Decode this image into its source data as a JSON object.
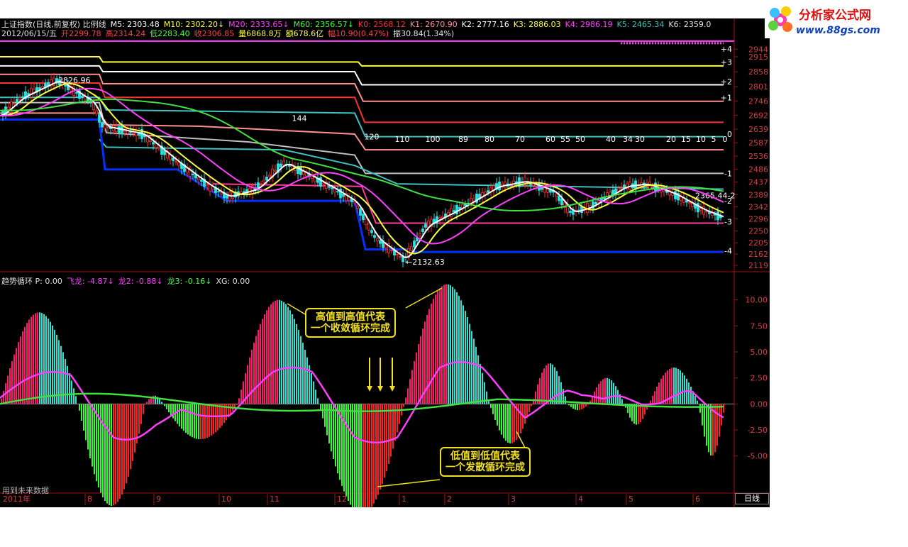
{
  "header": {
    "line1": [
      {
        "text": "上证指数(日线,前复权) 比例线",
        "color": "#e0e0e0"
      },
      {
        "text": "M5: 2303.48",
        "color": "#ffffff"
      },
      {
        "text": "M10: 2302.20↓",
        "color": "#ffff40"
      },
      {
        "text": "M20: 2333.65↓",
        "color": "#ff40ff"
      },
      {
        "text": "M60: 2356.57↓",
        "color": "#40ff40"
      },
      {
        "text": "K0: 2568.12",
        "color": "#ff3030"
      },
      {
        "text": "K1: 2670.90",
        "color": "#ff9090"
      },
      {
        "text": "K2: 2777.16",
        "color": "#ffffff"
      },
      {
        "text": "K3: 2886.03",
        "color": "#ffff40"
      },
      {
        "text": "K4: 2986.19",
        "color": "#ff40ff"
      },
      {
        "text": "K5: 2465.34",
        "color": "#40c0c0"
      },
      {
        "text": "K6: 2359.0",
        "color": "#e0e0e0"
      }
    ],
    "line2": [
      {
        "text": "2012/06/15/五",
        "color": "#e0e0e0"
      },
      {
        "text": "开2299.78",
        "color": "#ff4040"
      },
      {
        "text": "高2314.24",
        "color": "#ff4040"
      },
      {
        "text": "低2283.40",
        "color": "#40ff40"
      },
      {
        "text": "收2306.85",
        "color": "#ff4040"
      },
      {
        "text": "量6868.8万",
        "color": "#ffff40"
      },
      {
        "text": "额678.6亿",
        "color": "#ffff40"
      },
      {
        "text": "幅10.90(0.47%)",
        "color": "#ff4040"
      },
      {
        "text": "振30.84(1.34%)",
        "color": "#e0e0e0"
      }
    ]
  },
  "watermark": {
    "title": "分析家公式网",
    "url": "www.88gs.com"
  },
  "indicator_header": [
    {
      "text": "趋势循环  P: 0.00",
      "color": "#e0e0e0"
    },
    {
      "text": "飞龙: -4.87↓",
      "color": "#ff40ff"
    },
    {
      "text": "龙2: -0.88↓",
      "color": "#ff40ff"
    },
    {
      "text": "龙3: -0.16↓",
      "color": "#40ff40"
    },
    {
      "text": "XG: 0.00",
      "color": "#e0e0e0"
    }
  ],
  "notes": {
    "high": {
      "line1": "高值到高值代表",
      "line2": "一个收敛循环完成"
    },
    "low": {
      "line1": "低值到低值代表",
      "line2": "一个发散循环完成"
    }
  },
  "footer_text": "用到未来数据",
  "period_label": "日线",
  "year_label": "2011年",
  "chart_data": [
    {
      "type": "line",
      "name": "price-panel",
      "y_ticks": [
        2944,
        2915,
        2858,
        2801,
        2746,
        2692,
        2639,
        2587,
        2536,
        2486,
        2437,
        2389,
        2342,
        2296,
        2250,
        2205,
        2162,
        2119
      ],
      "ylim": [
        2100,
        2980
      ],
      "right_level_labels": [
        "+4",
        "+3",
        "+2",
        "+1",
        "0",
        "-1",
        "-2",
        "-3",
        "-4"
      ],
      "period_labels": [
        "144",
        "120",
        "110",
        "100",
        "89",
        "80",
        "70",
        "60",
        "55",
        "50",
        "40",
        "34",
        "30",
        "20",
        "15",
        "10",
        "5",
        "0"
      ],
      "annotations": [
        {
          "text": "2826.96",
          "color": "#ffffff"
        },
        {
          "text": "←2132.63",
          "color": "#ffffff"
        },
        {
          "text": "2365.44-2",
          "color": "#ffffff"
        }
      ],
      "x_month_labels": [
        "8",
        "9",
        "10",
        "11",
        "12",
        "1",
        "2",
        "3",
        "4",
        "5",
        "6"
      ]
    },
    {
      "type": "bar",
      "name": "trend-cycle-panel",
      "y_ticks": [
        "10.00",
        "7.50",
        "5.00",
        "2.50",
        "0.00",
        "-2.50",
        "-5.00"
      ],
      "ylim": [
        -8.5,
        12.5
      ],
      "series": [
        {
          "name": "飞龙",
          "color": "#ff40ff"
        },
        {
          "name": "龙3",
          "color": "#40ff40"
        }
      ]
    }
  ],
  "colors": {
    "bg": "#000000",
    "grid": "#a01010",
    "axis_text": "#d04040",
    "rising": "#ff1a70",
    "falling_top": "#30e0d0",
    "dropping": "#30ff30",
    "bottom_red": "#ff2020"
  }
}
